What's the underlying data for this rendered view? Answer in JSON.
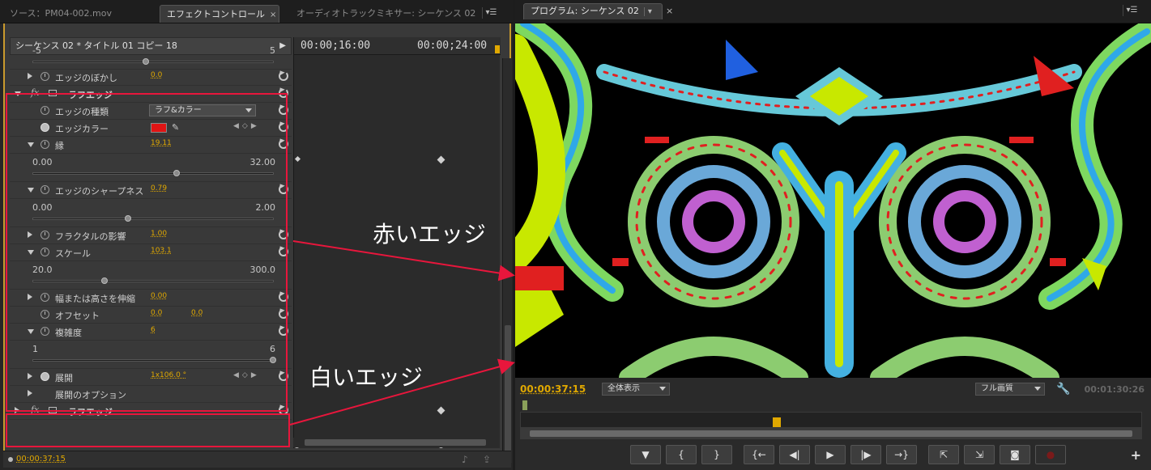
{
  "left_panel": {
    "tabs": [
      {
        "label": "ソース：PM04-002.mov"
      },
      {
        "label": "エフェクトコントロール"
      },
      {
        "label": "オーディオトラックミキサー: シーケンス 02"
      }
    ],
    "close_glyph": "×",
    "menu_glyph": "▾☰",
    "sequence_header": "シーケンス 02 * タイトル 01 コピー 18",
    "timeline_ruler": {
      "tc1": "00:00;16:00",
      "tc2": "00:00;24:00"
    },
    "timecode": "00:00:37:15",
    "rows": {
      "slider_top": {
        "min": "-5",
        "max": "5",
        "level": 0.47
      },
      "edge_blur": {
        "label": "エッジのぼかし",
        "value": "0.0"
      },
      "effect_name": "ラフエッジ",
      "edge_type": {
        "label": "エッジの種類",
        "value": "ラフ&カラー"
      },
      "edge_color": {
        "label": "エッジカラー",
        "color": "#e01414"
      },
      "border": {
        "label": "縁",
        "value": "19.11",
        "min": "0.00",
        "max": "32.00",
        "level": 0.597
      },
      "sharpness": {
        "label": "エッジのシャープネス",
        "value": "0.79",
        "min": "0.00",
        "max": "2.00",
        "level": 0.395
      },
      "fractal": {
        "label": "フラクタルの影響",
        "value": "1.00"
      },
      "scale": {
        "label": "スケール",
        "value": "103.1",
        "min": "20.0",
        "max": "300.0",
        "level": 0.297
      },
      "stretch": {
        "label": "幅または高さを伸縮",
        "value": "0.00"
      },
      "offset": {
        "label": "オフセット",
        "x": "0.0",
        "y": "0.0"
      },
      "complexity": {
        "label": "複雑度",
        "value": "6",
        "min": "1",
        "max": "6",
        "level": 1.0
      },
      "evolution": {
        "label": "展開",
        "value": "1x106.0 °"
      },
      "evolution_options": {
        "label": "展開のオプション"
      },
      "effect2_name": "ラフエッジ"
    }
  },
  "right_panel": {
    "tab": "プログラム: シーケンス 02",
    "close_glyph": "×",
    "timecode": "00:00:37:15",
    "zoom": "全体表示",
    "quality": "フル画質",
    "duration": "00:01:30:26",
    "playhead_position": 0.41,
    "buttons": [
      {
        "name": "marker",
        "glyph": "▼"
      },
      {
        "name": "mark-in",
        "glyph": "{"
      },
      {
        "name": "mark-out",
        "glyph": "}"
      },
      {
        "name": "go-to-in",
        "glyph": "{←"
      },
      {
        "name": "step-back",
        "glyph": "◀|"
      },
      {
        "name": "play",
        "glyph": "▶"
      },
      {
        "name": "step-forward",
        "glyph": "|▶"
      },
      {
        "name": "go-to-out",
        "glyph": "→}"
      },
      {
        "name": "lift",
        "glyph": "⇱"
      },
      {
        "name": "extract",
        "glyph": "⇲"
      },
      {
        "name": "export-frame",
        "glyph": "◙"
      },
      {
        "name": "record",
        "glyph": "●"
      }
    ],
    "plus_glyph": "+"
  },
  "annotations": {
    "red_edge": "赤いエッジ",
    "white_edge": "白いエッジ"
  },
  "colors": {
    "timecode": "#e0a800",
    "highlight_box": "#e8163c",
    "panel_focus": "#c99a2d"
  }
}
